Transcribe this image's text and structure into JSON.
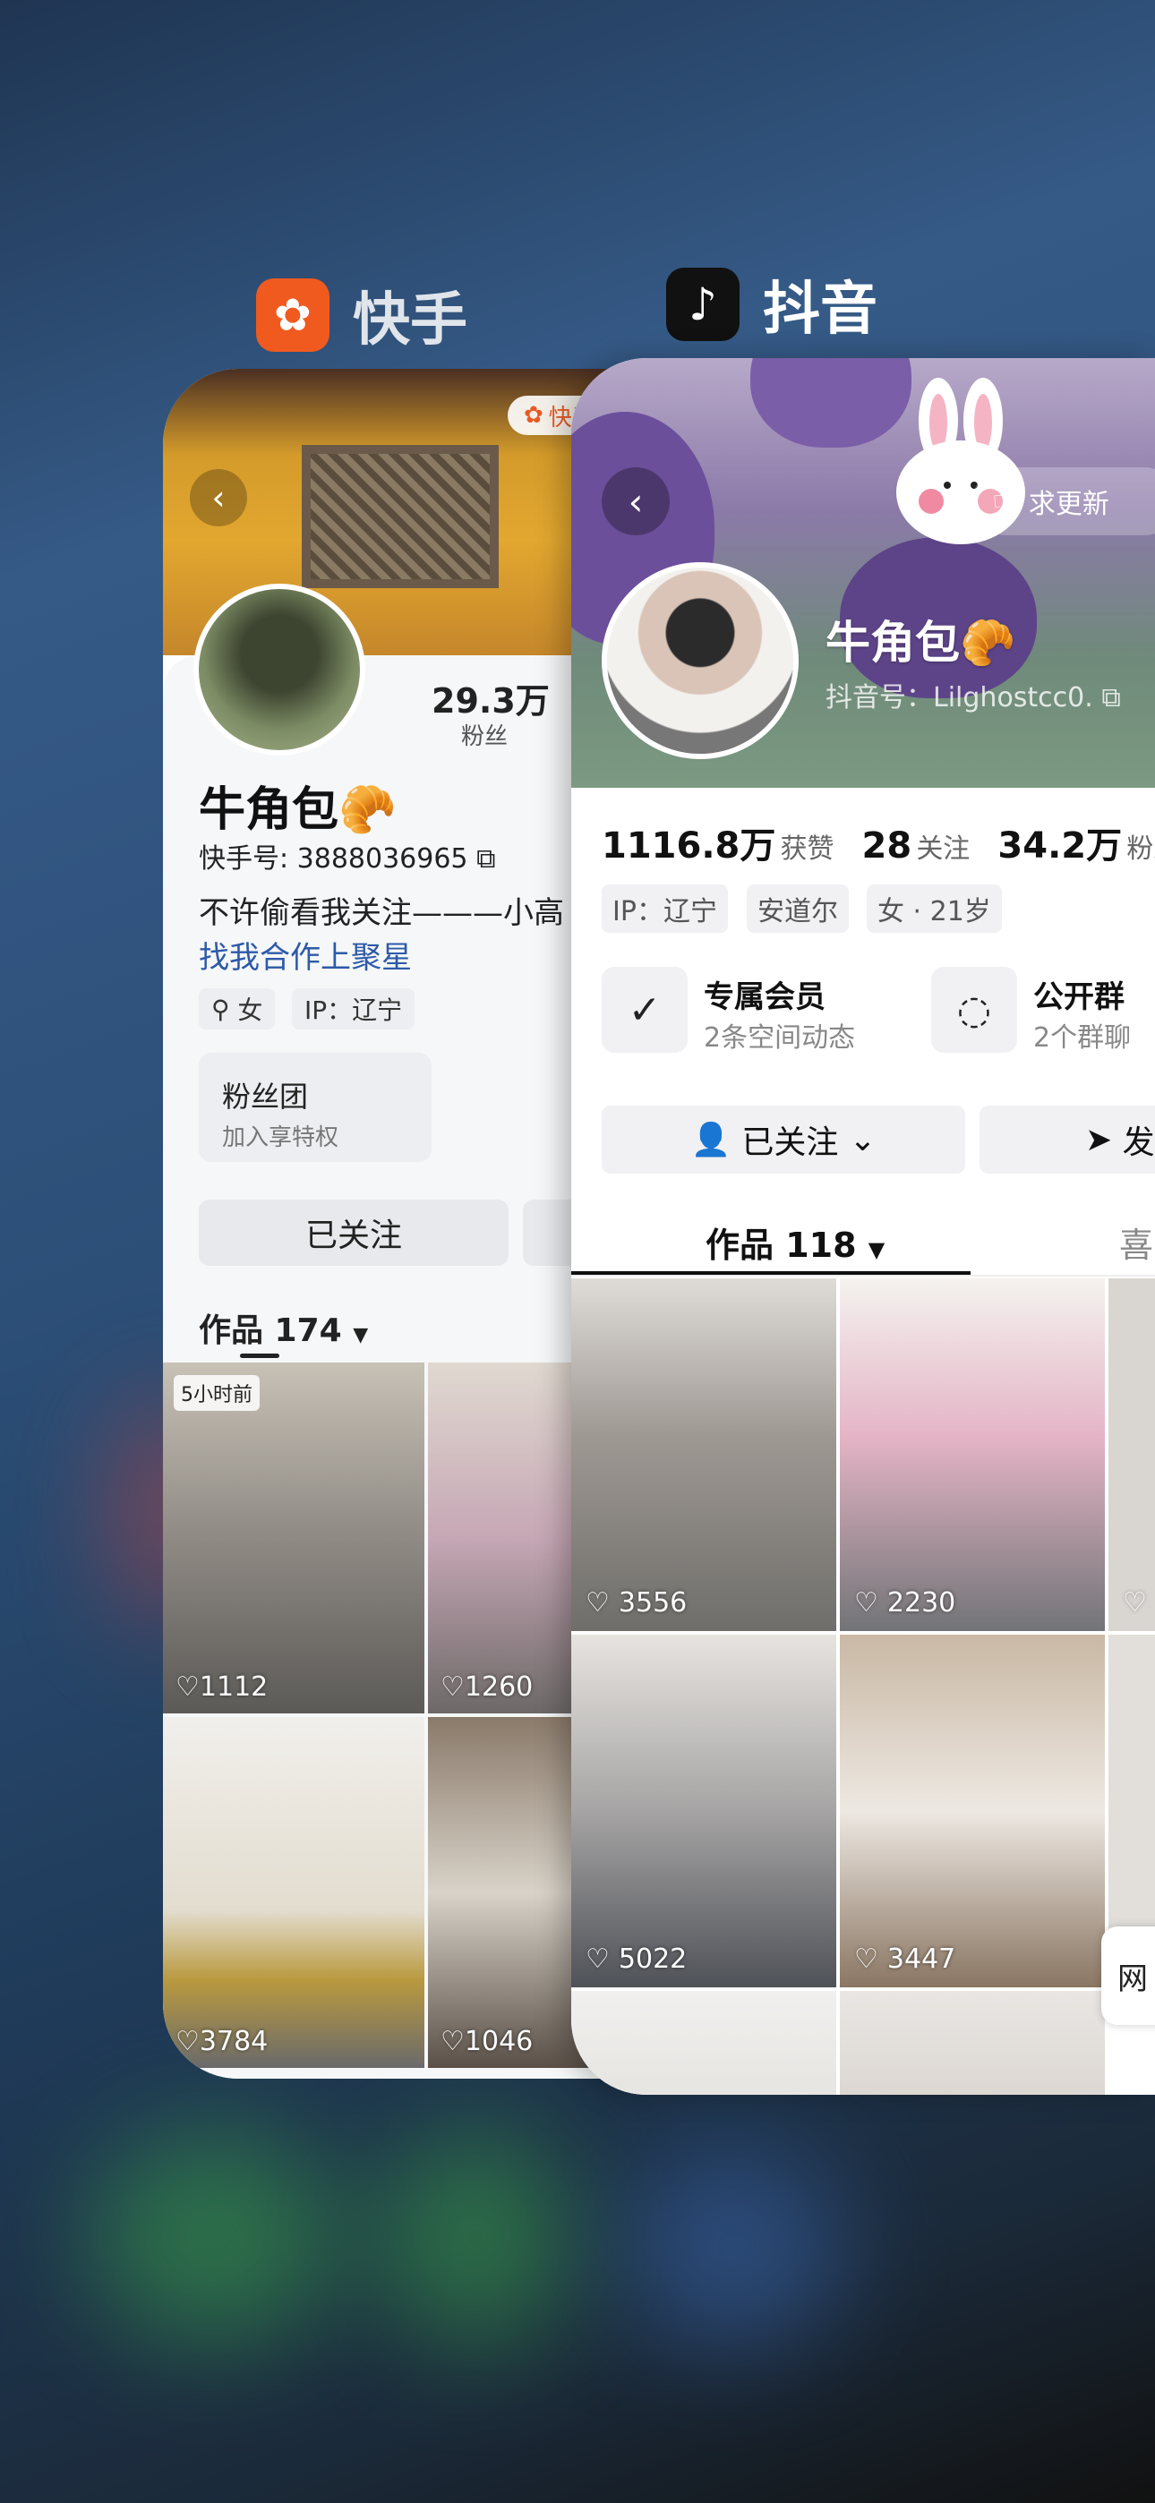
{
  "switcher": {
    "apps": [
      {
        "name": "快手",
        "icon": "kuaishou-icon"
      },
      {
        "name": "抖音",
        "icon": "douyin-icon"
      }
    ]
  },
  "kuaishou": {
    "badge": "快手",
    "stat_value": "29.3万",
    "stat_label": "粉丝",
    "name": "牛角包🥐",
    "id": "快手号: 3888036965",
    "bio": "不许偷看我关注———小高",
    "link": "找我合作上聚星",
    "tag_gender": "女",
    "tag_ip": "IP：辽宁",
    "fans_title": "粉丝团",
    "fans_sub": "加入享特权",
    "follow": "已关注",
    "works": "作品 174",
    "time_badge": "5小时前",
    "videos": [
      {
        "likes": "1112"
      },
      {
        "likes": "1260"
      },
      {
        "likes": "3784"
      },
      {
        "likes": "1046"
      }
    ]
  },
  "douyin": {
    "update": "求更新",
    "name": "牛角包🥐",
    "id": "抖音号：Lilghostcc0.",
    "stats": [
      {
        "value": "1116.8万",
        "label": "获赞"
      },
      {
        "value": "28",
        "label": "关注"
      },
      {
        "value": "34.2万",
        "label": "粉丝"
      }
    ],
    "tags": [
      "IP：辽宁",
      "安道尔",
      "女 · 21岁"
    ],
    "features": [
      {
        "title": "专属会员",
        "sub": "2条空间动态",
        "icon": "v-icon"
      },
      {
        "title": "公开群",
        "sub": "2个群聊",
        "icon": "chat-icon"
      }
    ],
    "follow": "已关注",
    "message": "发",
    "tab_works": "作品 118",
    "tab_likes": "喜",
    "float_text": "网",
    "videos": [
      {
        "likes": "3556"
      },
      {
        "likes": "2230"
      },
      {
        "likes": "5022"
      },
      {
        "likes": "3447"
      }
    ]
  }
}
